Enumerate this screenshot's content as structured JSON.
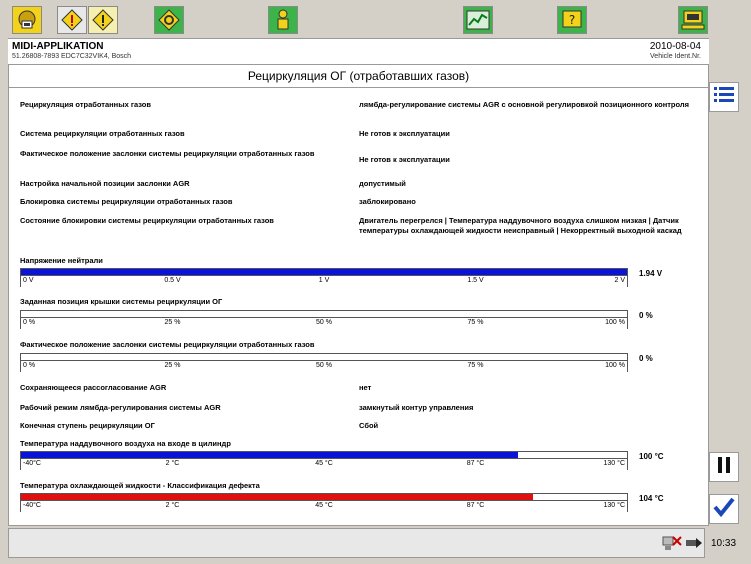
{
  "toolbar": {
    "icons": [
      "home-icon",
      "warning-icon",
      "warning-active-icon",
      "settings-icon",
      "person-icon",
      "chart-icon",
      "help-icon",
      "computer-icon"
    ]
  },
  "header": {
    "app_title": "MIDI-APPLIKATION",
    "ecu_info": "51.26808-7893   EDC7C32VIK4, Bosch",
    "date": "2010-08-04",
    "vehicle_label": "Vehicle Ident.Nr."
  },
  "page_title": "Рециркуляция ОГ (отработавших газов)",
  "params": [
    {
      "label": "Рециркуляция отработанных газов",
      "value": "лямбда-регулирование системы AGR с основной регулировкой позиционного контроля"
    },
    {
      "label": "Система рециркуляции отработанных газов",
      "value": "Не готов к эксплуатации"
    },
    {
      "label": "Фактическое положение заслонки системы рециркуляции отработанных газов",
      "value": "Не готов к эксплуатации"
    },
    {
      "label": "Настройка начальной позиции заслонки AGR",
      "value": "допустимый"
    },
    {
      "label": "Блокировка системы рециркуляции отработанных газов",
      "value": "заблокировано"
    },
    {
      "label": "Состояние блокировки системы рециркуляции отработанных газов",
      "value": "Двигатель перегрелся | Температура наддувочного воздуха слишком низкая | Датчик температуры охлаждающей жидкости неисправный | Некорректный выходной каскад"
    }
  ],
  "bars1": [
    {
      "label": "Напряжение нейтрали",
      "ticks": [
        "0 V",
        "0.5 V",
        "1 V",
        "1.5 V",
        "2 V"
      ],
      "fill": 1.0,
      "color": "#0a14d8",
      "value": "1.94 V"
    },
    {
      "label": "Заданная позиция крышки системы рециркуляции ОГ",
      "ticks": [
        "0 %",
        "25 %",
        "50 %",
        "75 %",
        "100 %"
      ],
      "fill": 0.0,
      "color": "#0a14d8",
      "value": "0 %"
    },
    {
      "label": "Фактическое положение заслонки системы рециркуляции отработанных газов",
      "ticks": [
        "0 %",
        "25 %",
        "50 %",
        "75 %",
        "100 %"
      ],
      "fill": 0.0,
      "color": "#0a14d8",
      "value": "0 %"
    }
  ],
  "params2": [
    {
      "label": "Сохраняющееся рассогласование AGR",
      "value": "нет"
    },
    {
      "label": "Рабочий режим лямбда-регулирования системы AGR",
      "value": "замкнутый контур управления"
    },
    {
      "label": "Конечная ступень рециркуляции ОГ",
      "value": "Сбой"
    }
  ],
  "bars2": [
    {
      "label": "Температура наддувочного воздуха на входе в цилиндр",
      "ticks": [
        "-40°C",
        "2 °C",
        "45 °C",
        "87 °C",
        "130 °C"
      ],
      "fill": 0.82,
      "color": "#0a14d8",
      "value": "100 °C"
    },
    {
      "label": "Температура охлаждающей жидкости - Классификация дефекта",
      "ticks": [
        "-40°C",
        "2 °C",
        "45 °C",
        "87 °C",
        "130 °C"
      ],
      "fill": 0.845,
      "color": "#e01010",
      "value": "104 °C"
    }
  ],
  "side_buttons": [
    "list-icon",
    "pause-icon",
    "check-icon"
  ],
  "status": {
    "time": "10:33",
    "icons": [
      "network-icon",
      "disconnected-icon"
    ]
  }
}
